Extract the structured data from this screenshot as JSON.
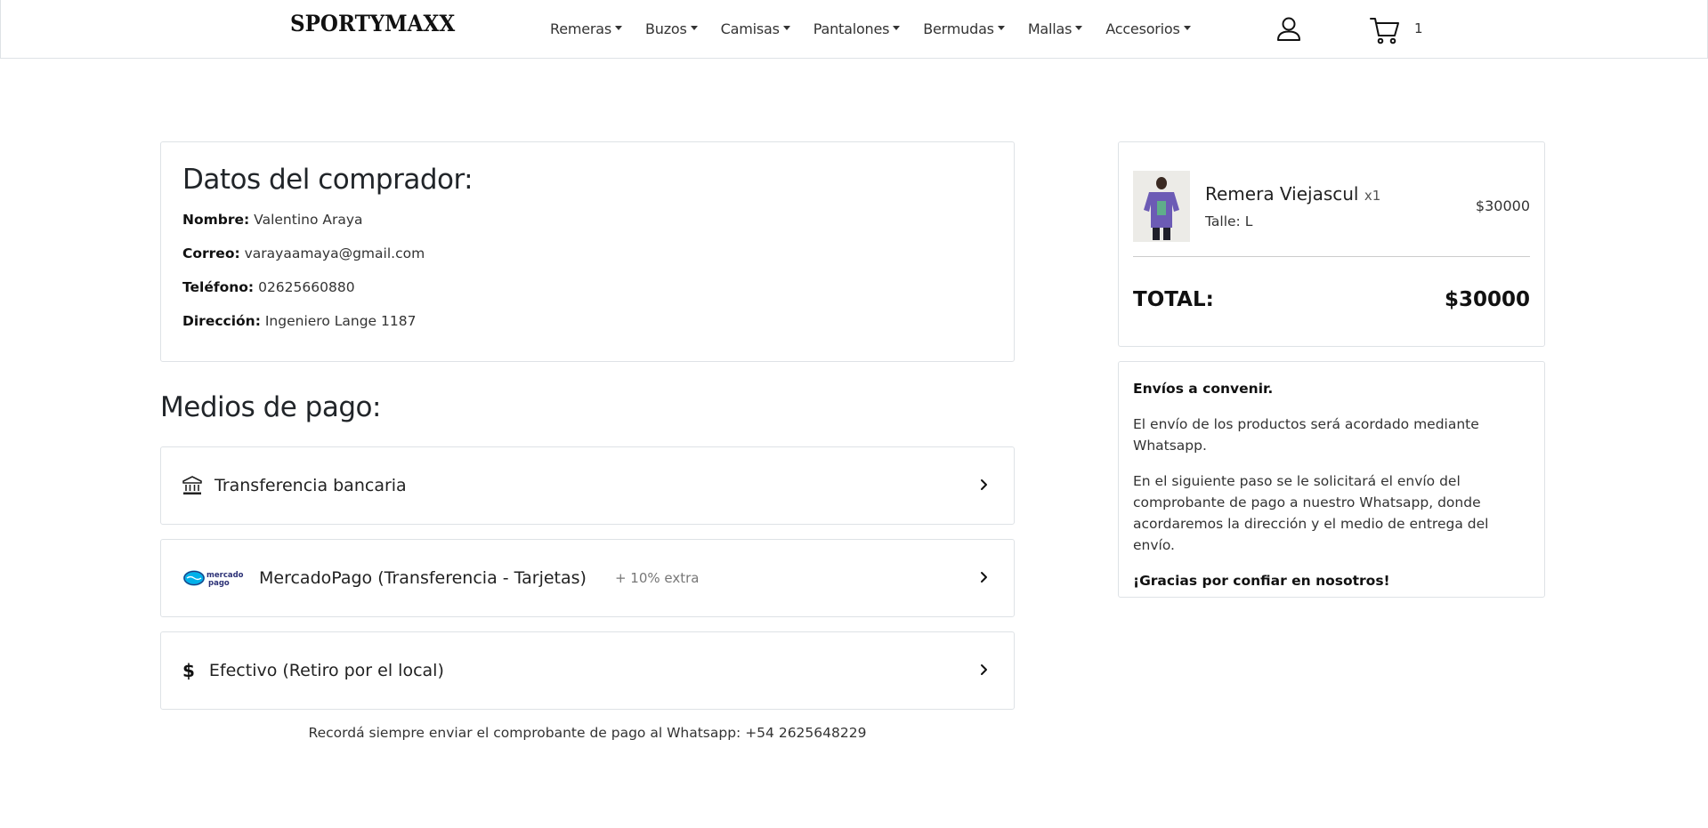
{
  "brand": "SPORTYMAXX",
  "nav": {
    "items": [
      "Remeras",
      "Buzos",
      "Camisas",
      "Pantalones",
      "Bermudas",
      "Mallas",
      "Accesorios"
    ],
    "cart_count": "1"
  },
  "buyer": {
    "title": "Datos del comprador:",
    "name_label": "Nombre:",
    "name_value": "Valentino Araya",
    "email_label": "Correo:",
    "email_value": "varayaamaya@gmail.com",
    "phone_label": "Teléfono:",
    "phone_value": "02625660880",
    "address_label": "Dirección:",
    "address_value": "Ingeniero Lange 1187"
  },
  "payment": {
    "heading": "Medios de pago:",
    "options": [
      {
        "label": "Transferencia bancaria",
        "icon": "bank-icon"
      },
      {
        "label": "MercadoPago (Transferencia - Tarjetas)",
        "extra": "+ 10% extra",
        "icon": "mercadopago-logo",
        "logo_text_1": "mercado",
        "logo_text_2": "pago"
      },
      {
        "label": "Efectivo (Retiro por el local)",
        "icon": "dollar-icon",
        "symbol": "$"
      }
    ],
    "reminder": "Recordá siempre enviar el comprobante de pago al Whatsapp: +54 2625648229"
  },
  "summary": {
    "product_name": "Remera Viejascul",
    "product_qty": "x1",
    "product_size": "Talle: L",
    "product_price": "$30000",
    "total_label": "TOTAL:",
    "total_value": "$30000"
  },
  "info": {
    "title": "Envíos a convenir.",
    "p1": "El envío de los productos será acordado mediante Whatsapp.",
    "p2": "En el siguiente paso se le solicitará el envío del comprobante de pago a nuestro Whatsapp, donde acordaremos la dirección y el medio de entrega del envío.",
    "thanks": "¡Gracias por confiar en nosotros!"
  },
  "colors": {
    "border": "#dee2e6",
    "text": "#212529",
    "mercadopago_blue": "#2d3277",
    "mercadopago_light": "#00b1ea"
  }
}
